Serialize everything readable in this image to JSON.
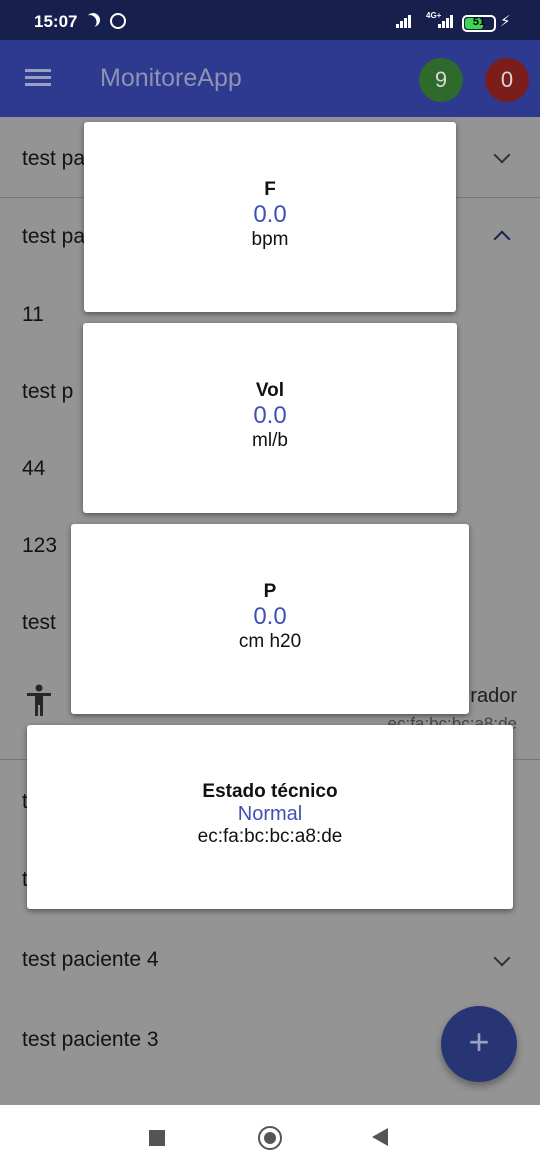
{
  "status_bar": {
    "time": "15:07",
    "network": "4G+",
    "battery": "51"
  },
  "app_bar": {
    "title": "MonitoreApp",
    "green_count": "9",
    "red_count": "0"
  },
  "background_list": {
    "row1": "test pa",
    "row2": "test pa",
    "detail_1": "11",
    "detail_2": "test p",
    "detail_3": "44",
    "detail_4": "123",
    "detail_5": "test",
    "detail_right": "rador",
    "detail_mac": "ec:fa:bc:bc:a8:de",
    "row3": "t",
    "row4": "t",
    "row5": "test paciente 4",
    "row6": "test paciente 3"
  },
  "cards": [
    {
      "title": "F",
      "value": "0.0",
      "unit": "bpm"
    },
    {
      "title": "Vol",
      "value": "0.0",
      "unit": "ml/b"
    },
    {
      "title": "P",
      "value": "0.0",
      "unit": "cm h20"
    },
    {
      "title": "Estado técnico",
      "value": "Normal",
      "unit": "ec:fa:bc:bc:a8:de"
    }
  ],
  "colors": {
    "app_bar": "#2d3a8f",
    "status_bar": "#17204d",
    "value_text": "#3f51b5",
    "badge_green": "#2d6a2c",
    "badge_red": "#7b1e1b"
  },
  "icons": [
    "hamburger-icon",
    "chevron-down-icon",
    "chevron-up-icon",
    "person-icon",
    "plus-icon",
    "nav-recents-icon",
    "nav-home-icon",
    "nav-back-icon"
  ]
}
